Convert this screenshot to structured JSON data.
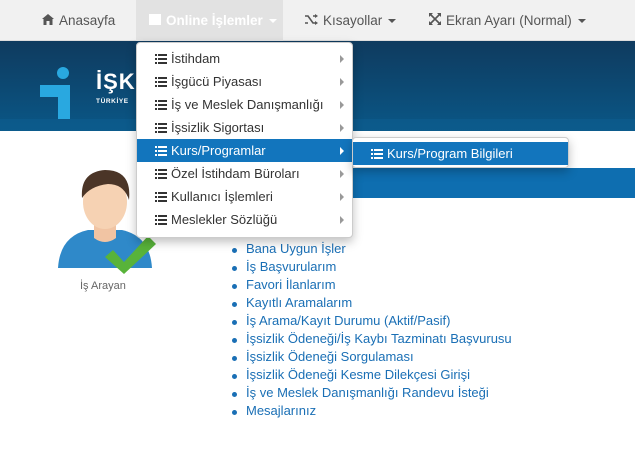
{
  "navbar": {
    "home_label": "Anasayfa",
    "online_label": "Online İşlemler",
    "shortcuts_label": "Kısayollar",
    "screen_label": "Ekran Ayarı (Normal)"
  },
  "banner": {
    "logo_text": "İŞK",
    "logo_sub": "TÜRKİYE"
  },
  "dropdown": {
    "items": [
      {
        "label": "İstihdam"
      },
      {
        "label": "İşgücü Piyasası"
      },
      {
        "label": "İş ve Meslek Danışmanlığı"
      },
      {
        "label": "İşsizlik Sigortası"
      },
      {
        "label": "Kurs/Programlar"
      },
      {
        "label": "Özel İstihdam Büroları"
      },
      {
        "label": "Kullanıcı İşlemleri"
      },
      {
        "label": "Meslekler Sözlüğü"
      }
    ],
    "selected_index": 4
  },
  "submenu": {
    "items": [
      {
        "label": "Kurs/Program Bilgileri"
      }
    ]
  },
  "profile": {
    "role_label": "İş Arayan"
  },
  "links": [
    "Bana Uygun İşler",
    "İş Başvurularım",
    "Favori İlanlarım",
    "Kayıtlı Aramalarım",
    "İş Arama/Kayıt Durumu (Aktif/Pasif)",
    "İşsizlik Ödeneği/İş Kaybı Tazminatı Başvurusu",
    "İşsizlik Ödeneği Sorgulaması",
    "İşsizlik Ödeneği Kesme Dilekçesi Girişi",
    "İş ve Meslek Danışmanlığı Randevu İsteği",
    "Mesajlarınız"
  ],
  "colors": {
    "accent": "#1275bd",
    "banner": "#0c4a74",
    "link": "#1a6fb5"
  },
  "icons": [
    "home-icon",
    "list-icon",
    "shuffle-icon",
    "arrows-expand-icon",
    "chevron-right-icon",
    "checkmark-icon"
  ]
}
